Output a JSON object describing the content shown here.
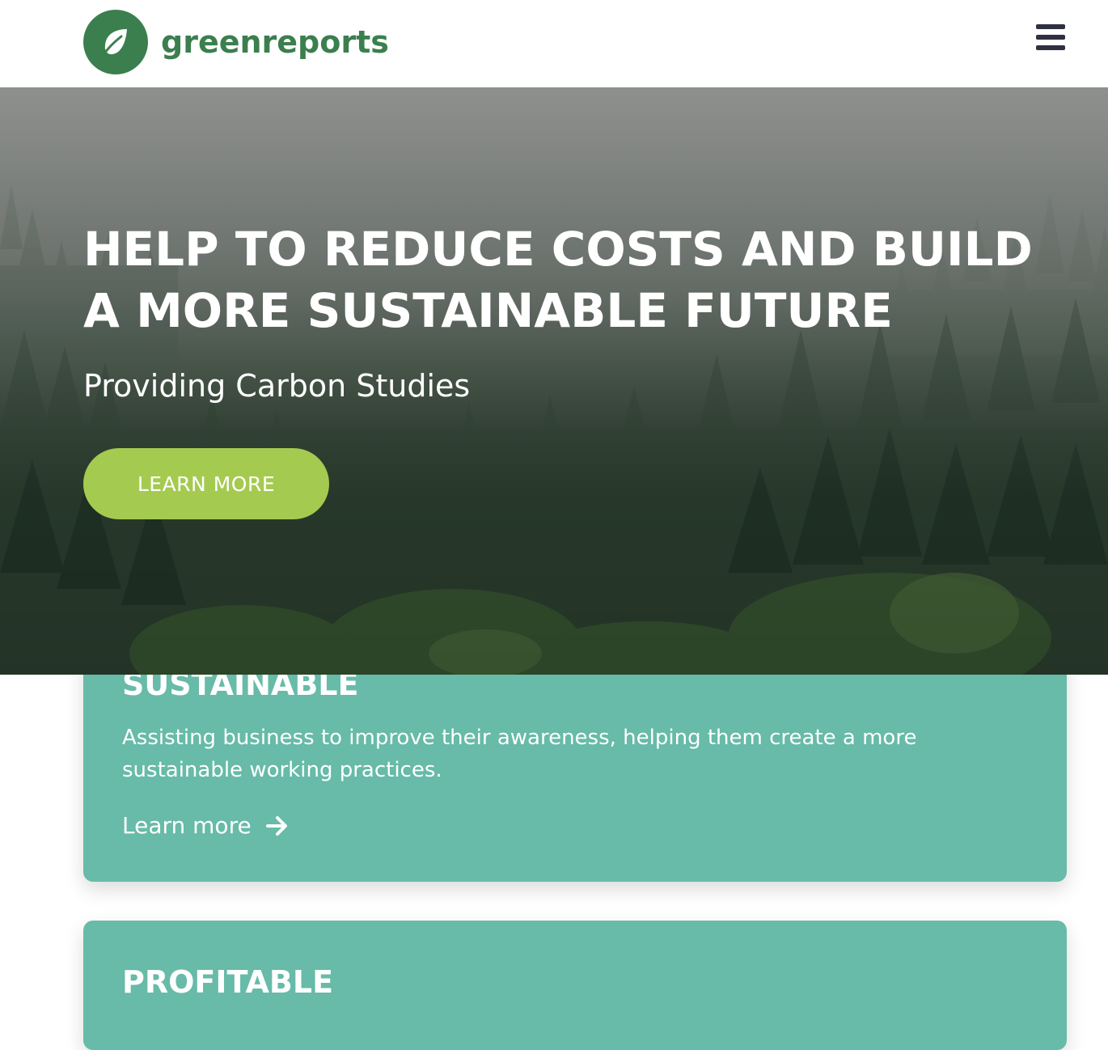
{
  "header": {
    "brand_name": "greenreports",
    "brand_color": "#3b7f4e",
    "logo_icon": "leaf-icon",
    "menu_icon": "hamburger-menu-icon"
  },
  "hero": {
    "title": "HELP TO REDUCE COSTS AND BUILD A MORE SUSTAINABLE FUTURE",
    "subtitle": "Providing Carbon Studies",
    "cta_label": "LEARN MORE",
    "cta_color": "#a5ca50",
    "background": "misty pine forest"
  },
  "cards": [
    {
      "title": "SUSTAINABLE",
      "body": "Assisting business to improve their awareness, helping them create a more sustainable working practices.",
      "link_label": "Learn more",
      "link_icon": "arrow-right-icon"
    },
    {
      "title": "PROFITABLE"
    }
  ],
  "card_color": "#67bba8"
}
